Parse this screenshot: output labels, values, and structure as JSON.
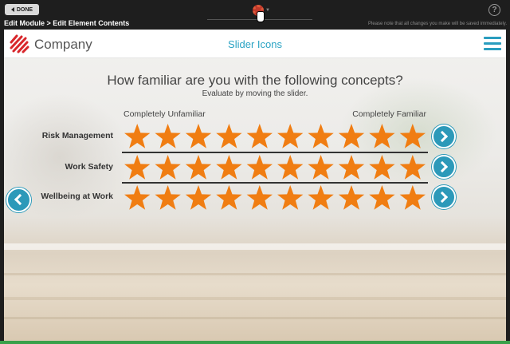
{
  "editor": {
    "done_label": "DONE",
    "breadcrumb": "Edit Module > Edit Element Contents",
    "notice": "Please note that all changes you make will be saved immediately.",
    "help_label": "?"
  },
  "header": {
    "logo_text": "Company",
    "title": "Slider Icons",
    "menu_icon": "hamburger-menu-icon"
  },
  "content": {
    "question": "How familiar are you with the following concepts?",
    "subtitle": "Evaluate by moving the slider.",
    "scale_min_label": "Completely Unfamiliar",
    "scale_max_label": "Completely Familiar",
    "rows": [
      {
        "label": "Risk Management",
        "rating": 10,
        "max": 10
      },
      {
        "label": "Work Safety",
        "rating": 10,
        "max": 10
      },
      {
        "label": "Wellbeing at Work",
        "rating": 10,
        "max": 10
      }
    ]
  },
  "colors": {
    "accent": "#2c99b9",
    "star": "#f07d12",
    "title": "#2aa3c4",
    "logo_red": "#d8262b"
  }
}
